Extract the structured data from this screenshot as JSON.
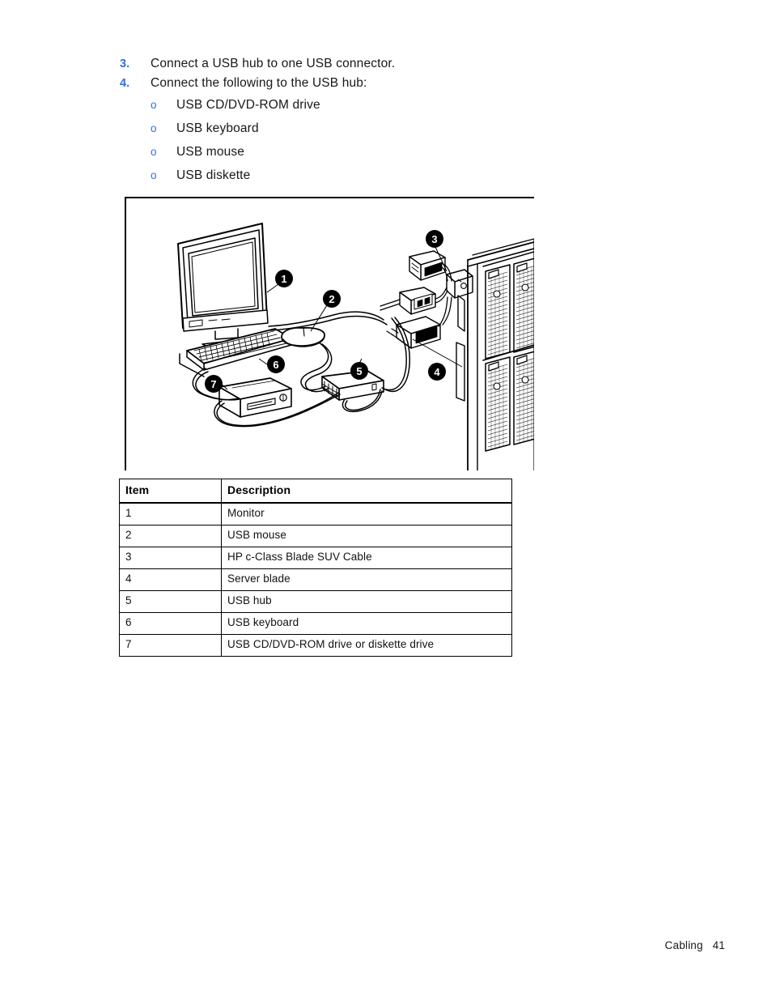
{
  "procedure": {
    "steps": [
      {
        "num": "3.",
        "text": "Connect a USB hub to one USB connector."
      },
      {
        "num": "4.",
        "text": "Connect the following to the USB hub:"
      }
    ],
    "sub_items": [
      {
        "bullet": "o",
        "text": "USB CD/DVD-ROM drive"
      },
      {
        "bullet": "o",
        "text": "USB keyboard"
      },
      {
        "bullet": "o",
        "text": "USB mouse"
      },
      {
        "bullet": "o",
        "text": "USB diskette"
      }
    ],
    "marker_color": "#2f6fdd"
  },
  "figure": {
    "name": "usb-hub-cabling-diagram",
    "callouts": [
      {
        "label": "1",
        "target": "monitor"
      },
      {
        "label": "2",
        "target": "usb-mouse"
      },
      {
        "label": "3",
        "target": "hp-c-class-blade-suv-cable"
      },
      {
        "label": "4",
        "target": "server-blade"
      },
      {
        "label": "5",
        "target": "usb-hub"
      },
      {
        "label": "6",
        "target": "usb-keyboard"
      },
      {
        "label": "7",
        "target": "usb-cd-dvd-rom-drive"
      }
    ]
  },
  "legend_table": {
    "headers": [
      "Item",
      "Description"
    ],
    "rows": [
      {
        "item": "1",
        "description": "Monitor"
      },
      {
        "item": "2",
        "description": "USB mouse"
      },
      {
        "item": "3",
        "description": "HP c-Class Blade SUV Cable"
      },
      {
        "item": "4",
        "description": "Server blade"
      },
      {
        "item": "5",
        "description": "USB hub"
      },
      {
        "item": "6",
        "description": "USB keyboard"
      },
      {
        "item": "7",
        "description": "USB CD/DVD-ROM drive or diskette drive"
      }
    ]
  },
  "footer": {
    "text": "Cabling   41"
  }
}
